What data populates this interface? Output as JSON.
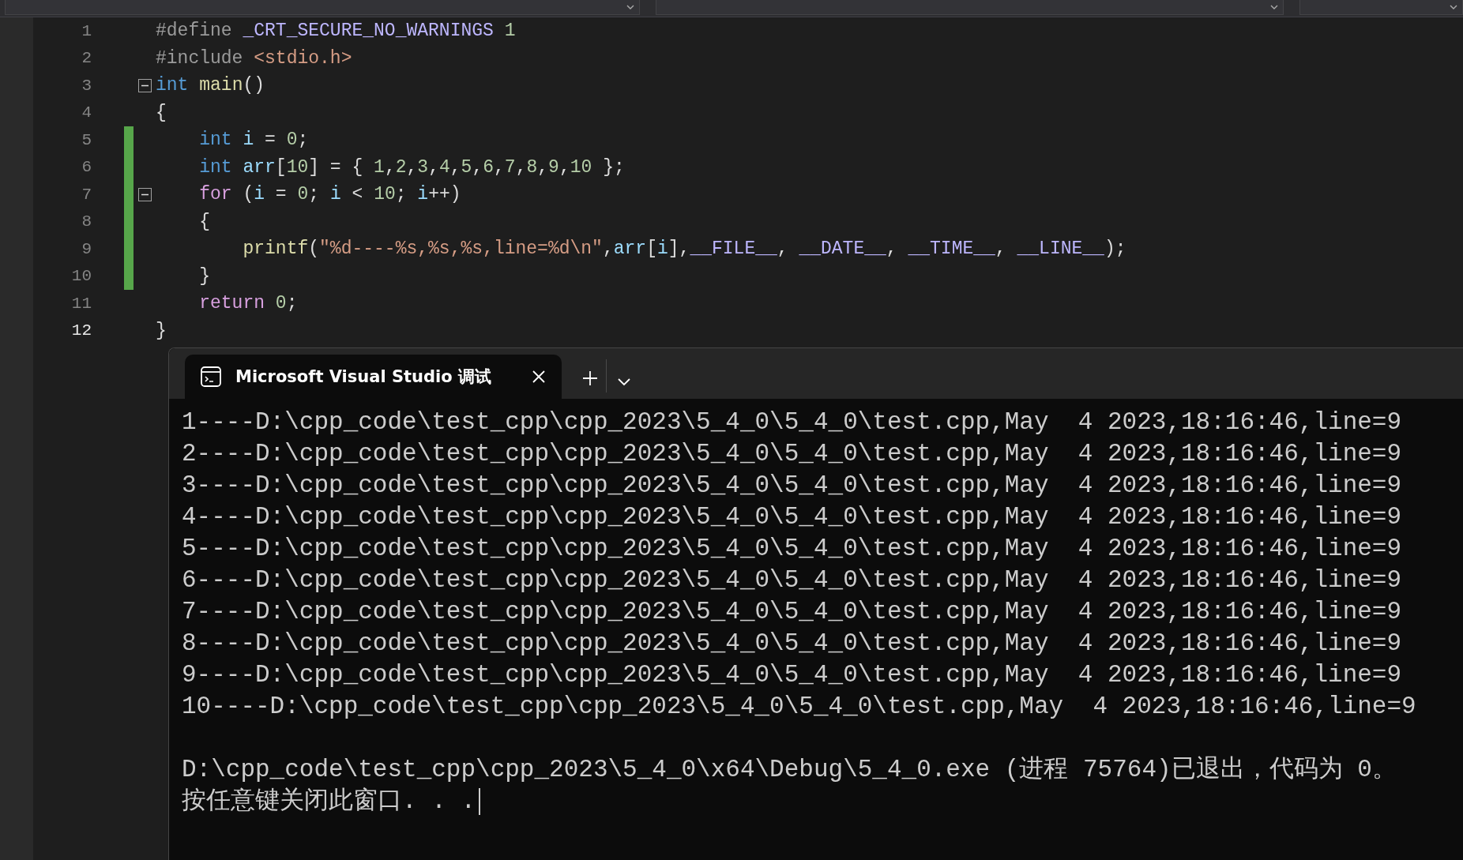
{
  "editor": {
    "lines": [
      {
        "number": "1",
        "current": false,
        "modified": false,
        "collapsible": false,
        "tokens": [
          {
            "text": "#define ",
            "kind": "preproc"
          },
          {
            "text": "_CRT_SECURE_NO_WARNINGS",
            "kind": "macro"
          },
          {
            "text": " 1",
            "kind": "number"
          }
        ]
      },
      {
        "number": "2",
        "current": false,
        "modified": false,
        "collapsible": false,
        "tokens": [
          {
            "text": "#include ",
            "kind": "preproc"
          },
          {
            "text": "<stdio.h>",
            "kind": "string"
          }
        ]
      },
      {
        "number": "3",
        "current": false,
        "modified": false,
        "collapsible": true,
        "tokens": [
          {
            "text": "int",
            "kind": "keyword"
          },
          {
            "text": " main",
            "kind": "func"
          },
          {
            "text": "()",
            "kind": "plain"
          }
        ]
      },
      {
        "number": "4",
        "current": false,
        "modified": false,
        "collapsible": false,
        "tokens": [
          {
            "text": "{",
            "kind": "plain"
          }
        ]
      },
      {
        "number": "5",
        "current": false,
        "modified": true,
        "collapsible": false,
        "tokens": [
          {
            "text": "    int",
            "kind": "keyword"
          },
          {
            "text": " i",
            "kind": "var"
          },
          {
            "text": " = ",
            "kind": "plain"
          },
          {
            "text": "0",
            "kind": "number"
          },
          {
            "text": ";",
            "kind": "plain"
          }
        ]
      },
      {
        "number": "6",
        "current": false,
        "modified": true,
        "collapsible": false,
        "tokens": [
          {
            "text": "    int",
            "kind": "keyword"
          },
          {
            "text": " arr",
            "kind": "var"
          },
          {
            "text": "[",
            "kind": "plain"
          },
          {
            "text": "10",
            "kind": "number"
          },
          {
            "text": "] = { ",
            "kind": "plain"
          },
          {
            "text": "1",
            "kind": "number"
          },
          {
            "text": ",",
            "kind": "plain"
          },
          {
            "text": "2",
            "kind": "number"
          },
          {
            "text": ",",
            "kind": "plain"
          },
          {
            "text": "3",
            "kind": "number"
          },
          {
            "text": ",",
            "kind": "plain"
          },
          {
            "text": "4",
            "kind": "number"
          },
          {
            "text": ",",
            "kind": "plain"
          },
          {
            "text": "5",
            "kind": "number"
          },
          {
            "text": ",",
            "kind": "plain"
          },
          {
            "text": "6",
            "kind": "number"
          },
          {
            "text": ",",
            "kind": "plain"
          },
          {
            "text": "7",
            "kind": "number"
          },
          {
            "text": ",",
            "kind": "plain"
          },
          {
            "text": "8",
            "kind": "number"
          },
          {
            "text": ",",
            "kind": "plain"
          },
          {
            "text": "9",
            "kind": "number"
          },
          {
            "text": ",",
            "kind": "plain"
          },
          {
            "text": "10",
            "kind": "number"
          },
          {
            "text": " };",
            "kind": "plain"
          }
        ]
      },
      {
        "number": "7",
        "current": false,
        "modified": true,
        "collapsible": true,
        "tokens": [
          {
            "text": "    for",
            "kind": "control"
          },
          {
            "text": " (",
            "kind": "plain"
          },
          {
            "text": "i",
            "kind": "var"
          },
          {
            "text": " = ",
            "kind": "plain"
          },
          {
            "text": "0",
            "kind": "number"
          },
          {
            "text": "; ",
            "kind": "plain"
          },
          {
            "text": "i",
            "kind": "var"
          },
          {
            "text": " < ",
            "kind": "plain"
          },
          {
            "text": "10",
            "kind": "number"
          },
          {
            "text": "; ",
            "kind": "plain"
          },
          {
            "text": "i",
            "kind": "var"
          },
          {
            "text": "++)",
            "kind": "plain"
          }
        ]
      },
      {
        "number": "8",
        "current": false,
        "modified": true,
        "collapsible": false,
        "tokens": [
          {
            "text": "    {",
            "kind": "plain"
          }
        ]
      },
      {
        "number": "9",
        "current": false,
        "modified": true,
        "collapsible": false,
        "tokens": [
          {
            "text": "        printf",
            "kind": "func"
          },
          {
            "text": "(",
            "kind": "plain"
          },
          {
            "text": "\"%d----%s,%s,%s,line=%d\\n\"",
            "kind": "string"
          },
          {
            "text": ",",
            "kind": "plain"
          },
          {
            "text": "arr",
            "kind": "var"
          },
          {
            "text": "[",
            "kind": "plain"
          },
          {
            "text": "i",
            "kind": "var"
          },
          {
            "text": "],",
            "kind": "plain"
          },
          {
            "text": "__FILE__",
            "kind": "macro"
          },
          {
            "text": ", ",
            "kind": "plain"
          },
          {
            "text": "__DATE__",
            "kind": "macro"
          },
          {
            "text": ", ",
            "kind": "plain"
          },
          {
            "text": "__TIME__",
            "kind": "macro"
          },
          {
            "text": ", ",
            "kind": "plain"
          },
          {
            "text": "__LINE__",
            "kind": "macro"
          },
          {
            "text": ");",
            "kind": "plain"
          }
        ]
      },
      {
        "number": "10",
        "current": false,
        "modified": true,
        "collapsible": false,
        "tokens": [
          {
            "text": "    }",
            "kind": "plain"
          }
        ]
      },
      {
        "number": "11",
        "current": false,
        "modified": false,
        "collapsible": false,
        "tokens": [
          {
            "text": "    return",
            "kind": "control"
          },
          {
            "text": " 0",
            "kind": "number"
          },
          {
            "text": ";",
            "kind": "plain"
          }
        ]
      },
      {
        "number": "12",
        "current": true,
        "modified": false,
        "collapsible": false,
        "tokens": [
          {
            "text": "}",
            "kind": "plain"
          }
        ]
      }
    ]
  },
  "terminal": {
    "tab": {
      "title": "Microsoft Visual Studio 调试",
      "selected": true
    },
    "output": [
      "1----D:\\cpp_code\\test_cpp\\cpp_2023\\5_4_0\\5_4_0\\test.cpp,May  4 2023,18:16:46,line=9",
      "2----D:\\cpp_code\\test_cpp\\cpp_2023\\5_4_0\\5_4_0\\test.cpp,May  4 2023,18:16:46,line=9",
      "3----D:\\cpp_code\\test_cpp\\cpp_2023\\5_4_0\\5_4_0\\test.cpp,May  4 2023,18:16:46,line=9",
      "4----D:\\cpp_code\\test_cpp\\cpp_2023\\5_4_0\\5_4_0\\test.cpp,May  4 2023,18:16:46,line=9",
      "5----D:\\cpp_code\\test_cpp\\cpp_2023\\5_4_0\\5_4_0\\test.cpp,May  4 2023,18:16:46,line=9",
      "6----D:\\cpp_code\\test_cpp\\cpp_2023\\5_4_0\\5_4_0\\test.cpp,May  4 2023,18:16:46,line=9",
      "7----D:\\cpp_code\\test_cpp\\cpp_2023\\5_4_0\\5_4_0\\test.cpp,May  4 2023,18:16:46,line=9",
      "8----D:\\cpp_code\\test_cpp\\cpp_2023\\5_4_0\\5_4_0\\test.cpp,May  4 2023,18:16:46,line=9",
      "9----D:\\cpp_code\\test_cpp\\cpp_2023\\5_4_0\\5_4_0\\test.cpp,May  4 2023,18:16:46,line=9",
      "10----D:\\cpp_code\\test_cpp\\cpp_2023\\5_4_0\\5_4_0\\test.cpp,May  4 2023,18:16:46,line=9"
    ],
    "exit_message": "D:\\cpp_code\\test_cpp\\cpp_2023\\5_4_0\\x64\\Debug\\5_4_0.exe (进程 75764)已退出，代码为 0。",
    "prompt": "按任意键关闭此窗口. . ."
  }
}
